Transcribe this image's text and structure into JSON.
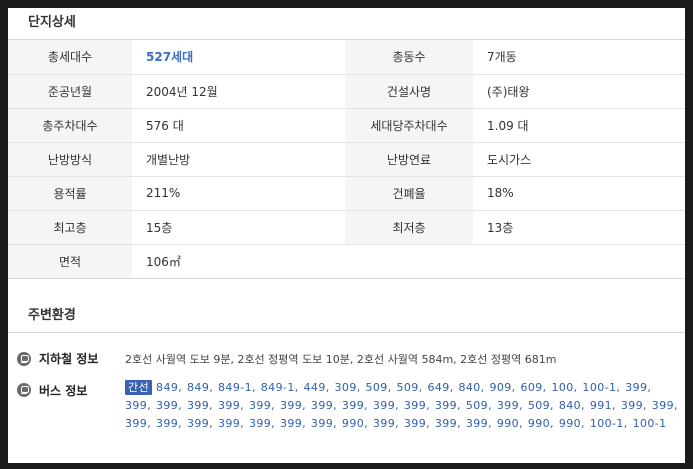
{
  "complex": {
    "title": "단지상세",
    "rows": [
      [
        {
          "label": "총세대수",
          "value": "527세대"
        },
        {
          "label": "총동수",
          "value": "7개동"
        }
      ],
      [
        {
          "label": "준공년월",
          "value": "2004년 12월"
        },
        {
          "label": "건설사명",
          "value": "(주)태왕"
        }
      ],
      [
        {
          "label": "총주차대수",
          "value": "576 대"
        },
        {
          "label": "세대당주차대수",
          "value": "1.09 대"
        }
      ],
      [
        {
          "label": "난방방식",
          "value": "개별난방"
        },
        {
          "label": "난방연료",
          "value": "도시가스"
        }
      ],
      [
        {
          "label": "용적률",
          "value": "211%"
        },
        {
          "label": "건폐율",
          "value": "18%"
        }
      ],
      [
        {
          "label": "최고층",
          "value": "15층"
        },
        {
          "label": "최저층",
          "value": "13층"
        }
      ],
      [
        {
          "label": "면적",
          "value": "106㎡"
        }
      ]
    ]
  },
  "environment": {
    "title": "주변환경",
    "subway": {
      "label": "지하철 정보",
      "icon": "subway-icon",
      "value": "2호선 사월역 도보 9분, 2호선 정평역 도보 10분, 2호선 사월역 584m, 2호선 정평역 681m"
    },
    "bus": {
      "label": "버스 정보",
      "icon": "bus-icon",
      "tag": "간선",
      "routes": "849, 849, 849-1, 849-1, 449, 309, 509, 509, 649, 840, 909, 609, 100, 100-1, 399, 399, 399, 399, 399, 399, 399, 399, 399, 399, 399, 399, 509, 399, 509, 840, 991, 399, 399, 399, 399, 399, 399, 399, 399, 399, 990, 399, 399, 399, 399, 990, 990, 990, 100-1, 100-1"
    }
  },
  "colors": {
    "background": "#1a1a1a",
    "panel": "#ffffff",
    "header_cell": "#f5f5f5",
    "accent_blue": "#3a6fc4",
    "bus_link": "#2f5fae",
    "bus_tag": "#3a62b0"
  }
}
